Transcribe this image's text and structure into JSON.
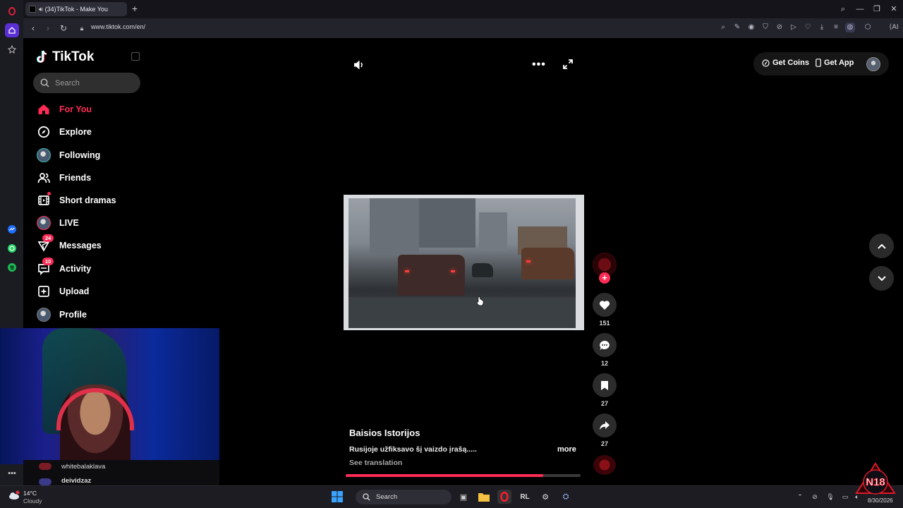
{
  "browser": {
    "tab_title": "(34)TikTok - Make You",
    "url": "www.tiktok.com/en/"
  },
  "tiktok": {
    "logo_text": "TikTok",
    "search_placeholder": "Search",
    "nav": [
      {
        "label": "For You",
        "icon": "home-icon",
        "active": true
      },
      {
        "label": "Explore",
        "icon": "compass-icon"
      },
      {
        "label": "Following",
        "icon": "following-avatar-icon"
      },
      {
        "label": "Friends",
        "icon": "friends-icon"
      },
      {
        "label": "Short dramas",
        "icon": "film-icon"
      },
      {
        "label": "LIVE",
        "icon": "live-avatar-icon"
      },
      {
        "label": "Messages",
        "icon": "messages-icon",
        "badge": "24"
      },
      {
        "label": "Activity",
        "icon": "activity-icon",
        "badge": "10"
      },
      {
        "label": "Upload",
        "icon": "upload-icon"
      },
      {
        "label": "Profile",
        "icon": "profile-avatar-icon"
      }
    ],
    "top_right": {
      "get_coins": "Get Coins",
      "get_app": "Get App"
    },
    "video": {
      "creator": "Baisios Istorijos",
      "caption": "Rusijoje užfiksavo šį vaizdo įrašą.....",
      "more_label": "more",
      "see_translation": "See translation",
      "progress": 0.84
    },
    "actions": {
      "likes": "151",
      "comments": "12",
      "bookmarks": "27",
      "shares": "27"
    }
  },
  "chat": {
    "names": [
      "whitebalaklava",
      "deividzaz"
    ]
  },
  "taskbar": {
    "weather_temp": "14°C",
    "weather_desc": "Cloudy",
    "search_label": "Search",
    "date": "8/30/2026"
  },
  "colors": {
    "accent": "#fe2c55",
    "background": "#000000"
  }
}
